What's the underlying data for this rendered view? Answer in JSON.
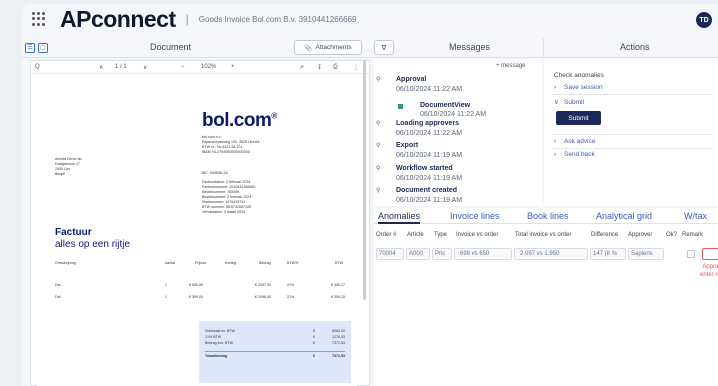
{
  "topbar": {
    "logo": "APconnect",
    "title": "Goods Invoice Bol.com B.v. 3910441266669",
    "avatar": "TD"
  },
  "toolbar": {
    "document_label": "Document",
    "attachments_label": "Attachments",
    "filter_label": "∇",
    "messages_label": "Messages",
    "actions_label": "Actions"
  },
  "viewer": {
    "search_icon": "Q",
    "up": "∧",
    "page": "1 / 1",
    "down": "∨",
    "zoom_out": "−",
    "zoom": "102%",
    "zoom_in": "+"
  },
  "doc": {
    "brand": "bol.com",
    "brand_mark": "®",
    "sender_lines": [
      "bol.com b.v.",
      "Papendorpseweg 100, 3528 Utrecht",
      "BTW nr.: NL 8101.54.701",
      "IBAN: NL27INGB0000000000"
    ],
    "recipient_lines": [
      "Amista Demo Nv",
      "Doelgebouw 17",
      "2500 Lier",
      "België"
    ],
    "meta_lines": [
      "BIC: INGBNL2A",
      "Factuurdatum: 2 februari 2024",
      "Factuurnummer: 3910441266669",
      "Bestelnummer: 760069",
      "Bestelnummer: 2 februari 2024",
      "Klantnummer: 1676425741",
      "BTW nummer: BE0732667105",
      "Vervaldatum: 3 maart 2024"
    ],
    "heading": "Factuur",
    "subheading": "alles op een rijtje",
    "cols": [
      "Omschrijving",
      "Aantal",
      "Prijs/st",
      "Korting",
      "Bedrag",
      "BTW%",
      "BTW"
    ],
    "rows": [
      [
        "Del...",
        "1",
        "€ 550,00",
        "",
        "€ 2097,00",
        "21%",
        "€ 340,17"
      ],
      [
        "Del...",
        "1",
        "€ 399,00",
        "",
        "€ 2098,00",
        "21%",
        "€ 309,15"
      ]
    ],
    "totals": [
      [
        "Subtotaal ex. BTW",
        "€",
        "6065,00"
      ],
      [
        "21% BTW",
        "€",
        "1276,53"
      ],
      [
        "Bedrag incl. BTW",
        "€",
        "7372,53"
      ]
    ],
    "total_label": "Totaalbedrag",
    "total_cur": "€",
    "total_value": "7372,53"
  },
  "messages": {
    "new_message": "+ message",
    "items": [
      {
        "title": "Approval",
        "date": "06/10/2024 11:22 AM",
        "sub_title": "DocumentView",
        "sub_date": "06/10/2024 11:22 AM"
      },
      {
        "title": "Loading approvers",
        "date": "06/10/2024 11:22 AM"
      },
      {
        "title": "Export",
        "date": "06/10/2024 11:19 AM"
      },
      {
        "title": "Workflow started",
        "date": "06/10/2024 11:19 AM"
      },
      {
        "title": "Document created",
        "date": "06/10/2024 11:19 AM"
      }
    ]
  },
  "actions": {
    "title": "Check anomalies",
    "save": "Save session",
    "submit_toggle": "Submit",
    "submit_btn": "Submit",
    "ask": "Ask advice",
    "send_back": "Send back"
  },
  "grid": {
    "tabs": [
      "Anomalies",
      "Invoice lines",
      "Book lines",
      "Analytical grid",
      "W/tax"
    ],
    "headers": [
      "Order #",
      "Article",
      "Type",
      "Invoice vs order",
      "Total invoice vs order",
      "Difference",
      "Approver",
      "Ok?",
      "Remark"
    ],
    "row": {
      "order": "70004",
      "article": "A000",
      "type": "Pric",
      "ivo": "699 vs 650",
      "tivo": "2.097 vs 1.950",
      "diff": "147 (8 %",
      "approver": "Sapiens"
    },
    "hint": "Approve or enter remark"
  }
}
